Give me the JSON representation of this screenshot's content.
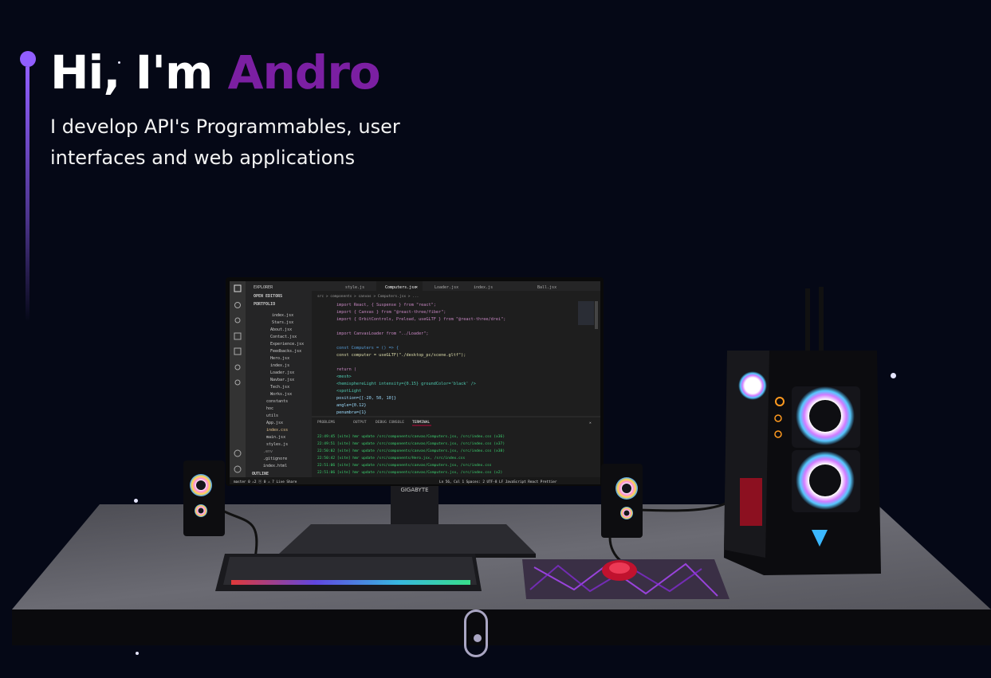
{
  "hero": {
    "greeting": "Hi, I'm ",
    "name": "Andro",
    "subtitle": "I develop API's Programmables, user interfaces and web applications"
  },
  "monitor": {
    "brand": "GIGABYTE",
    "explorer_title": "EXPLORER",
    "open_editors": "OPEN EDITORS",
    "folder": "PORTFOLIO",
    "files": [
      "index.jsx",
      "Stars.jsx",
      "About.jsx",
      "Contact.jsx",
      "Experience.jsx",
      "Feedbacks.jsx",
      "Hero.jsx",
      "index.js",
      "Loader.jsx",
      "Navbar.jsx",
      "Tech.jsx",
      "Works.jsx"
    ],
    "folders": [
      "constants",
      "hoc",
      "utils"
    ],
    "root_files": [
      "App.jsx",
      "index.css",
      "main.jsx",
      "styles.js",
      ".env",
      ".gitignore",
      "index.html"
    ],
    "outline": "OUTLINE",
    "tabs": [
      "style.js",
      "Computers.jsx",
      "Loader.jsx",
      "index.js",
      "Ball.jsx"
    ],
    "breadcrumb": "src > components > canvas > Computers.jsx > ...",
    "code": [
      "import React, { Suspense } from \"react\";",
      "import { Canvas } from \"@react-three/fiber\";",
      "import { OrbitControls, Preload, useGLTF } from \"@react-three/drei\";",
      "",
      "import CanvasLoader from \"../Loader\";",
      "",
      "const Computers = () => {",
      "  const computer = useGLTF(\"./desktop_pc/scene.gltf\");",
      "",
      "  return (",
      "    <mesh>",
      "      <hemisphereLight intensity={0.15} groundColor='black' />",
      "      <spotLight",
      "        position={[-20, 50, 10]}",
      "        angle={0.12}",
      "        penumbra={1}"
    ],
    "panel_tabs": [
      "PROBLEMS",
      "OUTPUT",
      "DEBUG CONSOLE",
      "TERMINAL"
    ],
    "terminal": [
      "22:49:45 [vite] hmr update /src/components/canvas/Computers.jsx, /src/index.css (x36)",
      "22:49:51 [vite] hmr update /src/components/canvas/Computers.jsx, /src/index.css (x37)",
      "22:50:02 [vite] hmr update /src/components/canvas/Computers.jsx, /src/index.css (x38)",
      "22:50:42 [vite] hmr update /src/components/Hero.jsx, /src/index.css",
      "22:51:06 [vite] hmr update /src/components/canvas/Computers.jsx, /src/index.css",
      "22:51:06 [vite] hmr update /src/components/canvas/Computers.jsx, /src/index.css (x2)",
      "22:52:09 [vite] hmr update /src/components/canvas/Computers.jsx, /src/index.css (x3)"
    ],
    "statusbar_left": "master  0 ⚠2  ⓧ 0 ⚠ 7  Live Share",
    "statusbar_right": "Ln 56, Col 1  Spaces: 2  UTF-8  LF  JavaScript React  Prettier"
  },
  "colors": {
    "background": "#050816",
    "accent": "#915eff",
    "name": "#7b1fa2"
  }
}
